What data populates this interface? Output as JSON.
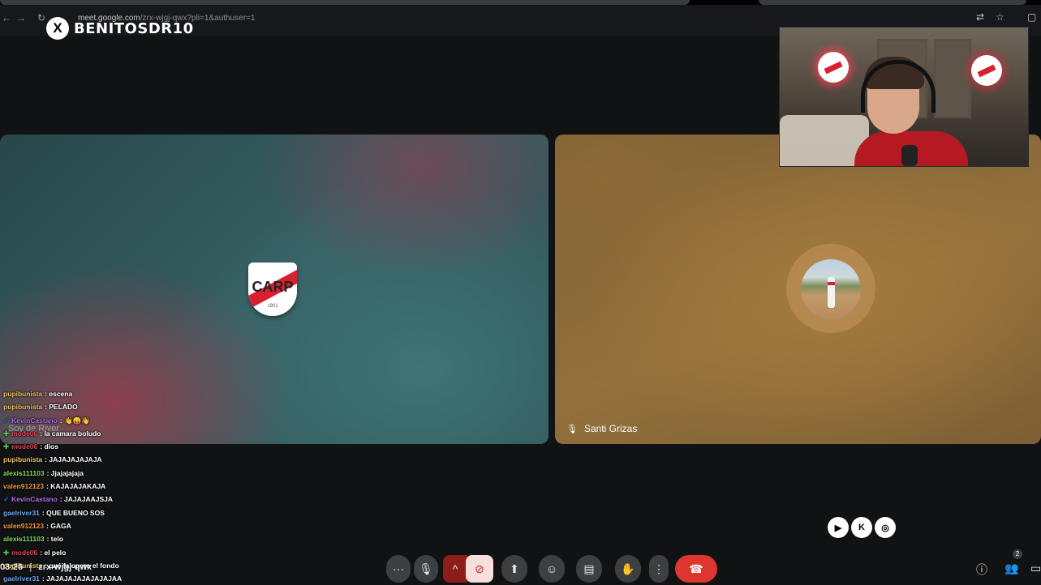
{
  "browser": {
    "url_host": "meet.google.com",
    "url_path": "/zrx-wjgj-qwx?pli=1&authuser=1"
  },
  "watermark": {
    "handle": "BENITOSDR10"
  },
  "tiles": [
    {
      "name": "Soy de River"
    },
    {
      "name": "Santi Grizas"
    }
  ],
  "chat": [
    {
      "user": "pupibunista",
      "message": ": escena",
      "color": "#f0c35a",
      "badge": ""
    },
    {
      "user": "pupibunista",
      "message": ": PELADO",
      "color": "#f0c35a",
      "badge": ""
    },
    {
      "user": "KevinCastano",
      "message": ": 👋😛👋",
      "color": "#b06cf0",
      "badge": "check"
    },
    {
      "user": "mode06",
      "message": ": la camara boludo",
      "color": "#e0455a",
      "badge": "mod"
    },
    {
      "user": "mode06",
      "message": ": dios",
      "color": "#e0455a",
      "badge": "mod"
    },
    {
      "user": "pupibunista",
      "message": ": JAJAJAJAJAJA",
      "color": "#f0c35a",
      "badge": ""
    },
    {
      "user": "alexis111103",
      "message": ": Jjajajajaja",
      "color": "#7be05c",
      "badge": ""
    },
    {
      "user": "valen912123",
      "message": ": KAJAJAJAKAJA",
      "color": "#f09a3c",
      "badge": ""
    },
    {
      "user": "KevinCastano",
      "message": ": JAJAJAAJSJA",
      "color": "#b06cf0",
      "badge": "check"
    },
    {
      "user": "gaelriver31",
      "message": ": QUE BUENO SOS",
      "color": "#6fa8f0",
      "badge": ""
    },
    {
      "user": "valen912123",
      "message": ": GAGA",
      "color": "#f09a3c",
      "badge": ""
    },
    {
      "user": "alexis111103",
      "message": ": telo",
      "color": "#7be05c",
      "badge": ""
    },
    {
      "user": "mode06",
      "message": ": el pelo",
      "color": "#e0455a",
      "badge": "mod"
    },
    {
      "user": "pupibunista",
      "message": ": qué falopero el fondo",
      "color": "#f0c35a",
      "badge": ""
    },
    {
      "user": "gaelriver31",
      "message": ": JAJAJAJAJAJAJAJAA",
      "color": "#6fa8f0",
      "badge": ""
    }
  ],
  "call": {
    "time": "03:26",
    "code": "zrx-wjgj-qwx"
  },
  "participants_count": "2",
  "controls": {
    "more_options": "···",
    "mic": "🎙",
    "caret": "^",
    "camera_off": "⊘",
    "present": "⬆",
    "emoji": "☺",
    "captions": "▤",
    "raise_hand": "✋",
    "kebab": "⋮",
    "leave": "☎"
  },
  "colors": {
    "leave": "#dc362e",
    "camera_off_bg": "#f9dedc",
    "control_bg": "#3c4043"
  }
}
